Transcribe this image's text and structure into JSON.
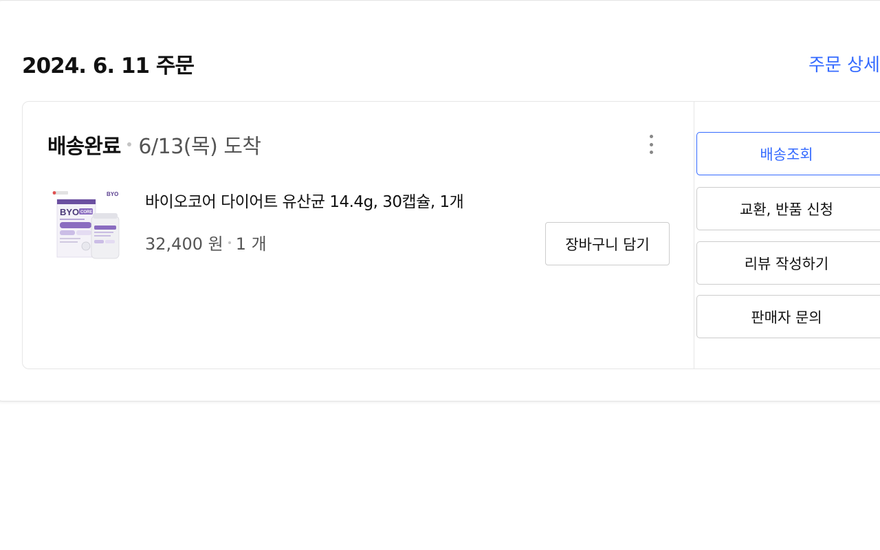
{
  "order": {
    "date_title": "2024. 6. 11 주문",
    "detail_link": "주문 상세보기"
  },
  "shipment": {
    "status": "배송완료",
    "arrival": "6/13(목) 도착"
  },
  "product": {
    "name": "바이오코어 다이어트 유산균 14.4g, 30캡슐, 1개",
    "price": "32,400 원",
    "quantity": "1 개",
    "image_brand": "BYO",
    "image_brand_sub": "CORE",
    "image_label": "다이어트 유산균"
  },
  "buttons": {
    "add_to_cart": "장바구니 담기",
    "track_delivery": "배송조회",
    "exchange_return": "교환, 반품 신청",
    "write_review": "리뷰 작성하기",
    "seller_inquiry": "판매자 문의"
  },
  "colors": {
    "accent": "#346aff",
    "text_primary": "#111111",
    "text_secondary": "#555555",
    "border": "#cccccc",
    "product_purple": "#6b4fa0"
  },
  "icons": {
    "more": "more-vertical-icon"
  }
}
